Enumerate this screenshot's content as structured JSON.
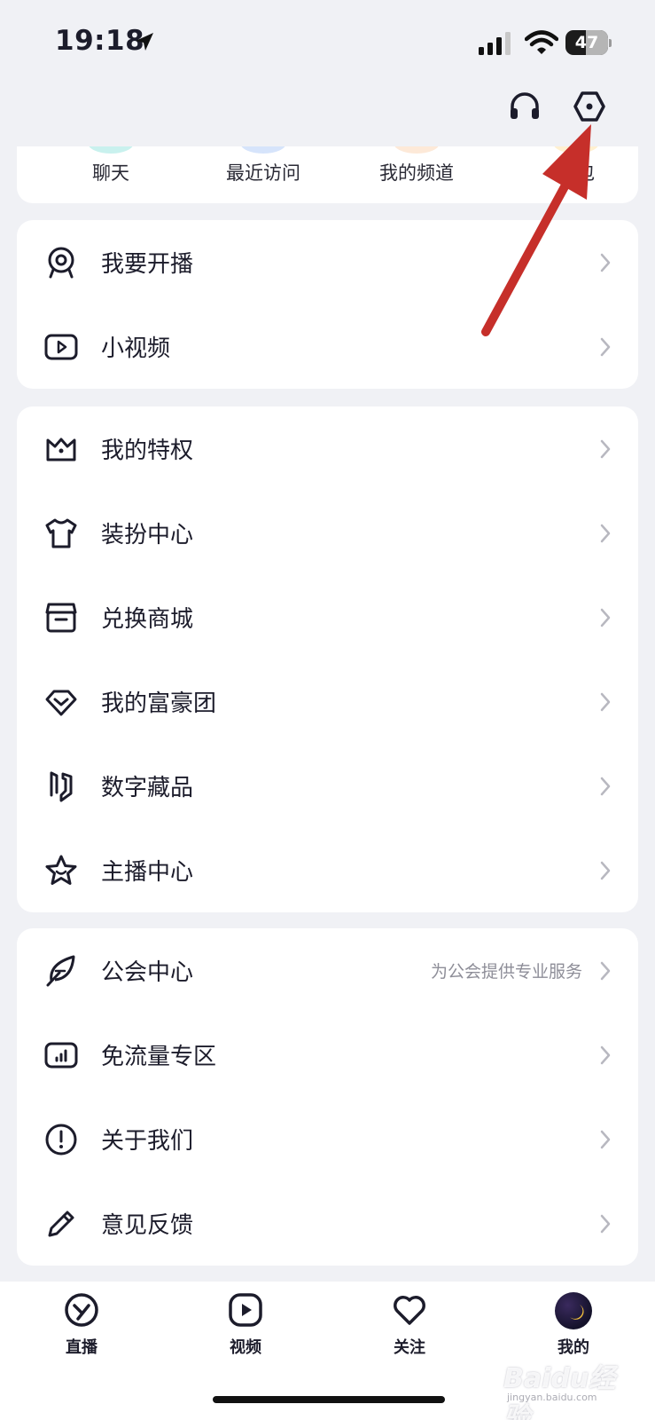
{
  "status_bar": {
    "time": "19:18",
    "battery": "47",
    "battery_level": 0.47
  },
  "quick_links": [
    {
      "label": "聊天",
      "dot_color": "#c9f1ee"
    },
    {
      "label": "最近访问",
      "dot_color": "#d6e4fb"
    },
    {
      "label": "我的频道",
      "dot_color": "#fde9d8"
    },
    {
      "label": "钱包",
      "dot_color": "#fff0d0"
    }
  ],
  "menu_group_1": [
    {
      "label": "我要开播",
      "icon": "webcam-icon"
    },
    {
      "label": "小视频",
      "icon": "video-play-icon"
    }
  ],
  "menu_group_2": [
    {
      "label": "我的特权",
      "icon": "crown-icon"
    },
    {
      "label": "装扮中心",
      "icon": "tshirt-icon"
    },
    {
      "label": "兑换商城",
      "icon": "store-icon"
    },
    {
      "label": "我的富豪团",
      "icon": "diamond-icon"
    },
    {
      "label": "数字藏品",
      "icon": "collectible-icon"
    },
    {
      "label": "主播中心",
      "icon": "star-icon"
    }
  ],
  "menu_group_3": [
    {
      "label": "公会中心",
      "sub": "为公会提供专业服务",
      "icon": "feather-icon"
    },
    {
      "label": "免流量专区",
      "icon": "data-chart-icon"
    },
    {
      "label": "关于我们",
      "icon": "info-icon"
    },
    {
      "label": "意见反馈",
      "icon": "pencil-icon"
    }
  ],
  "tabbar": [
    {
      "label": "直播",
      "icon": "live-icon"
    },
    {
      "label": "视频",
      "icon": "video-icon"
    },
    {
      "label": "关注",
      "icon": "heart-icon"
    },
    {
      "label": "我的",
      "icon": "avatar"
    }
  ],
  "watermark": {
    "text": "Baidu经验",
    "sub": "jingyan.baidu.com"
  },
  "colors": {
    "annotation": "#c62f2a",
    "icon_stroke": "#1c1c2b",
    "chevron": "#b8b8c0"
  }
}
